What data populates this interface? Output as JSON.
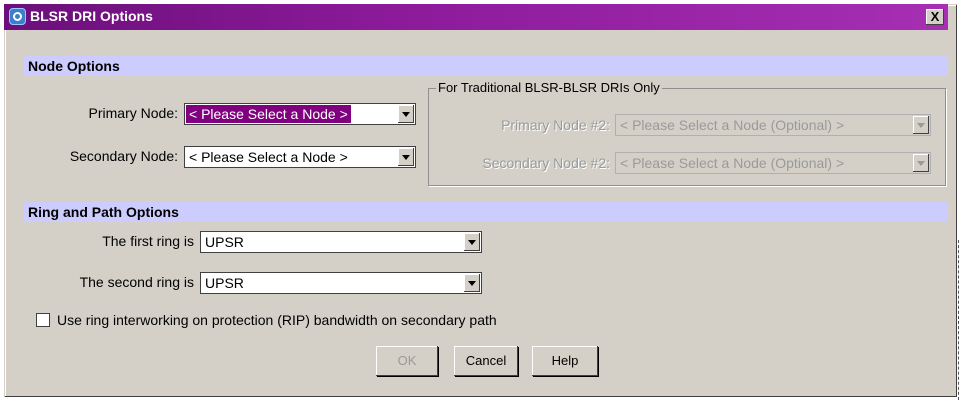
{
  "window": {
    "title": "BLSR DRI Options",
    "close_label": "X"
  },
  "node_options": {
    "header": "Node Options",
    "primary_label": "Primary Node:",
    "primary_value": "< Please Select a Node >",
    "secondary_label": "Secondary Node:",
    "secondary_value": "< Please Select a Node >"
  },
  "traditional_group": {
    "legend": "For Traditional BLSR-BLSR DRIs Only",
    "primary2_label": "Primary Node #2:",
    "primary2_value": "< Please Select a Node (Optional) >",
    "secondary2_label": "Secondary Node #2:",
    "secondary2_value": "< Please Select a Node (Optional) >"
  },
  "ring_options": {
    "header": "Ring and Path Options",
    "first_ring_label": "The first ring is",
    "first_ring_value": "UPSR",
    "second_ring_label": "The second ring is",
    "second_ring_value": "UPSR",
    "rip_checkbox_label": "Use ring interworking on protection (RIP) bandwidth on secondary path",
    "rip_checked": false
  },
  "buttons": {
    "ok": "OK",
    "cancel": "Cancel",
    "help": "Help"
  },
  "colors": {
    "title_bar": "#800080",
    "section_header": "#ccccff",
    "dialog_bg": "#d4d0c8"
  }
}
